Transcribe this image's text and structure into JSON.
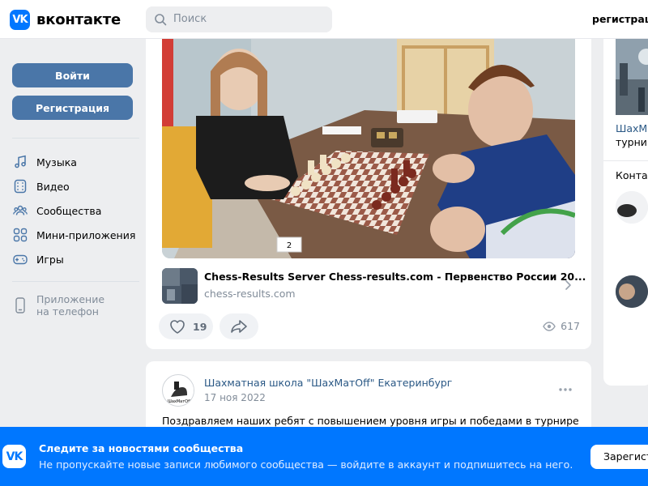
{
  "header": {
    "logo_text": "вконтакте",
    "logo_mark": "VK",
    "search_placeholder": "Поиск",
    "register_link": "регистрация"
  },
  "sidebar": {
    "login_button": "Войти",
    "register_button": "Регистрация",
    "items": [
      {
        "label": "Музыка",
        "icon": "music-icon"
      },
      {
        "label": "Видео",
        "icon": "video-icon"
      },
      {
        "label": "Сообщества",
        "icon": "communities-icon"
      },
      {
        "label": "Мини-приложения",
        "icon": "mini-apps-icon"
      },
      {
        "label": "Игры",
        "icon": "gamepad-icon"
      }
    ],
    "app_link": {
      "line1": "Приложение",
      "line2": "на телефон",
      "icon": "phone-icon"
    }
  },
  "feed": {
    "post1": {
      "link_title": "Chess-Results Server Chess-results.com - Первенство России 20...",
      "link_domain": "chess-results.com",
      "photo_card_number": "2",
      "likes": "19",
      "views": "617"
    },
    "post2": {
      "author": "Шахматная школа \"ШахМатOff\" Екатеринбург",
      "date": "17 ноя 2022",
      "text": "Поздравляем наших ребят с повышением уровня игры и победами в турнире",
      "avatar_text": "ШахМатOff"
    }
  },
  "right_column": {
    "thumb_title_line1": "ШахМа",
    "thumb_title_line2": "турнир",
    "contacts_label": "Конта"
  },
  "banner": {
    "logo_mark": "VK",
    "title": "Следите за новостями сообщества",
    "subtitle": "Не пропускайте новые записи любимого сообщества — войдите в аккаунт и подпишитесь на него.",
    "button": "Зарегистр"
  },
  "colors": {
    "brand": "#0077ff",
    "button": "#4a76a8",
    "background": "#edeef0",
    "link": "#2a5885",
    "muted": "#818c99"
  }
}
